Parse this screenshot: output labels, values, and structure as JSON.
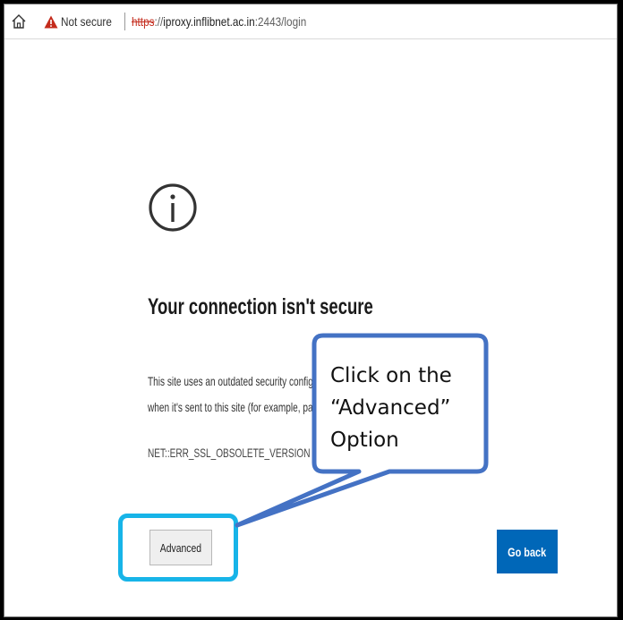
{
  "browser": {
    "security_label": "Not secure",
    "url_scheme": "https",
    "url_host": "iproxy.inflibnet.ac.in",
    "url_rest": ":2443/login",
    "icons": {
      "home": "home-icon",
      "warning": "warning-icon"
    },
    "warning_color": "#c42b1c"
  },
  "page": {
    "icon": "info-icon",
    "title": "Your connection isn't secure",
    "description_line1": "This site uses an outdated security configuration, which may expose your information",
    "description_line2": "when it's sent to this site (for example, passwords, messages or credit cards).",
    "error_code": "NET::ERR_SSL_OBSOLETE_VERSION",
    "advanced_label": "Advanced",
    "go_back_label": "Go back",
    "go_back_color": "#0067b8"
  },
  "annotation": {
    "callout_line1": "Click on the",
    "callout_line2": "“Advanced”",
    "callout_line3": "Option",
    "border_color": "#4472c4",
    "highlight_color": "#17b4e8"
  }
}
